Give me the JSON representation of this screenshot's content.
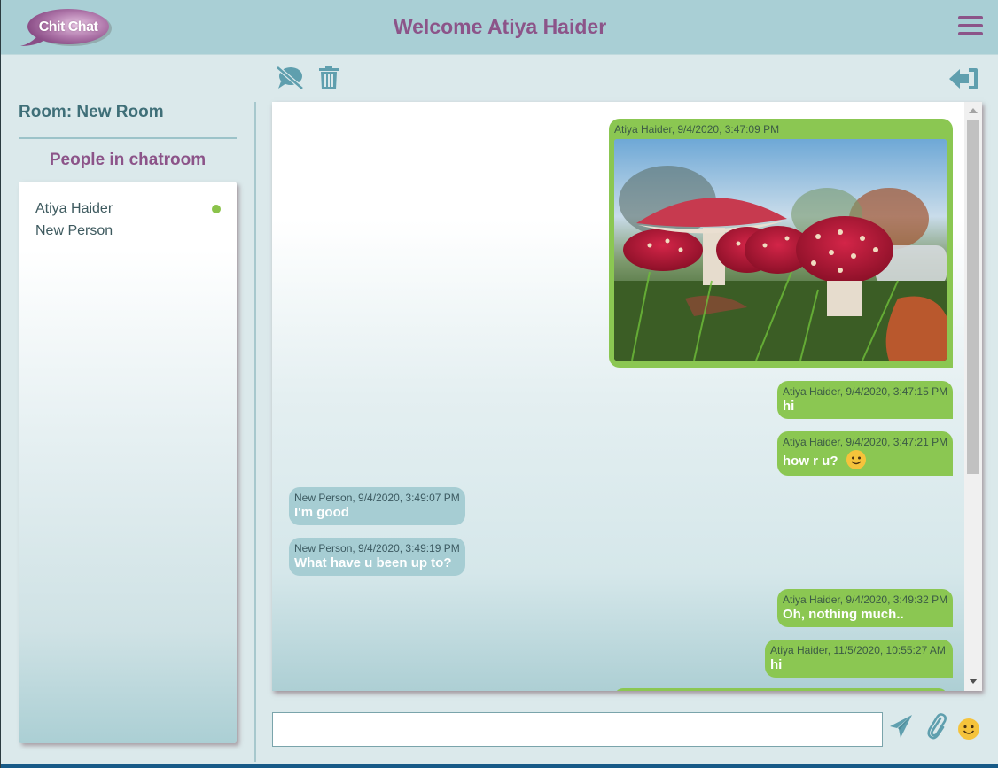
{
  "header": {
    "logo_text": "Chit Chat",
    "welcome": "Welcome Atiya Haider",
    "menu_icon": "hamburger-menu-icon"
  },
  "sidebar": {
    "room_title": "Room: New Room",
    "people_title": "People in chatroom",
    "people": [
      {
        "name": "Atiya Haider",
        "online": true
      },
      {
        "name": "New Person",
        "online": false
      }
    ]
  },
  "toolbar": {
    "icons": [
      "hide-chat-icon",
      "delete-icon",
      "leave-room-icon"
    ]
  },
  "messages": [
    {
      "sender": "Atiya Haider",
      "meta": "Atiya Haider, 9/4/2020, 3:47:09 PM",
      "type": "image",
      "image_alt": "Red fly agaric mushrooms in grass",
      "mine": true
    },
    {
      "sender": "Atiya Haider",
      "meta": "Atiya Haider, 9/4/2020, 3:47:15 PM",
      "text": "hi",
      "mine": true
    },
    {
      "sender": "Atiya Haider",
      "meta": "Atiya Haider, 9/4/2020, 3:47:21 PM",
      "text": "how r u?",
      "emoji": "🙂",
      "mine": true
    },
    {
      "sender": "New Person",
      "meta": "New Person, 9/4/2020, 3:49:07 PM",
      "text": "I'm good",
      "mine": false
    },
    {
      "sender": "New Person",
      "meta": "New Person, 9/4/2020, 3:49:19 PM",
      "text": "What have u been up to?",
      "mine": false
    },
    {
      "sender": "Atiya Haider",
      "meta": "Atiya Haider, 9/4/2020, 3:49:32 PM",
      "text": "Oh, nothing much..",
      "mine": true
    },
    {
      "sender": "Atiya Haider",
      "meta": "Atiya Haider, 11/5/2020, 10:55:27 AM",
      "text": "hi",
      "mine": true
    }
  ],
  "composer": {
    "value": "",
    "placeholder": "",
    "icons": [
      "send-icon",
      "attach-icon",
      "emoji-icon"
    ]
  },
  "colors": {
    "accent_purple": "#8c5489",
    "header_bg": "#a9cfd5",
    "my_bubble": "#8bc752",
    "their_bubble": "#a6cdd3",
    "online": "#8bc34a",
    "icon_teal": "#5f9fae"
  }
}
